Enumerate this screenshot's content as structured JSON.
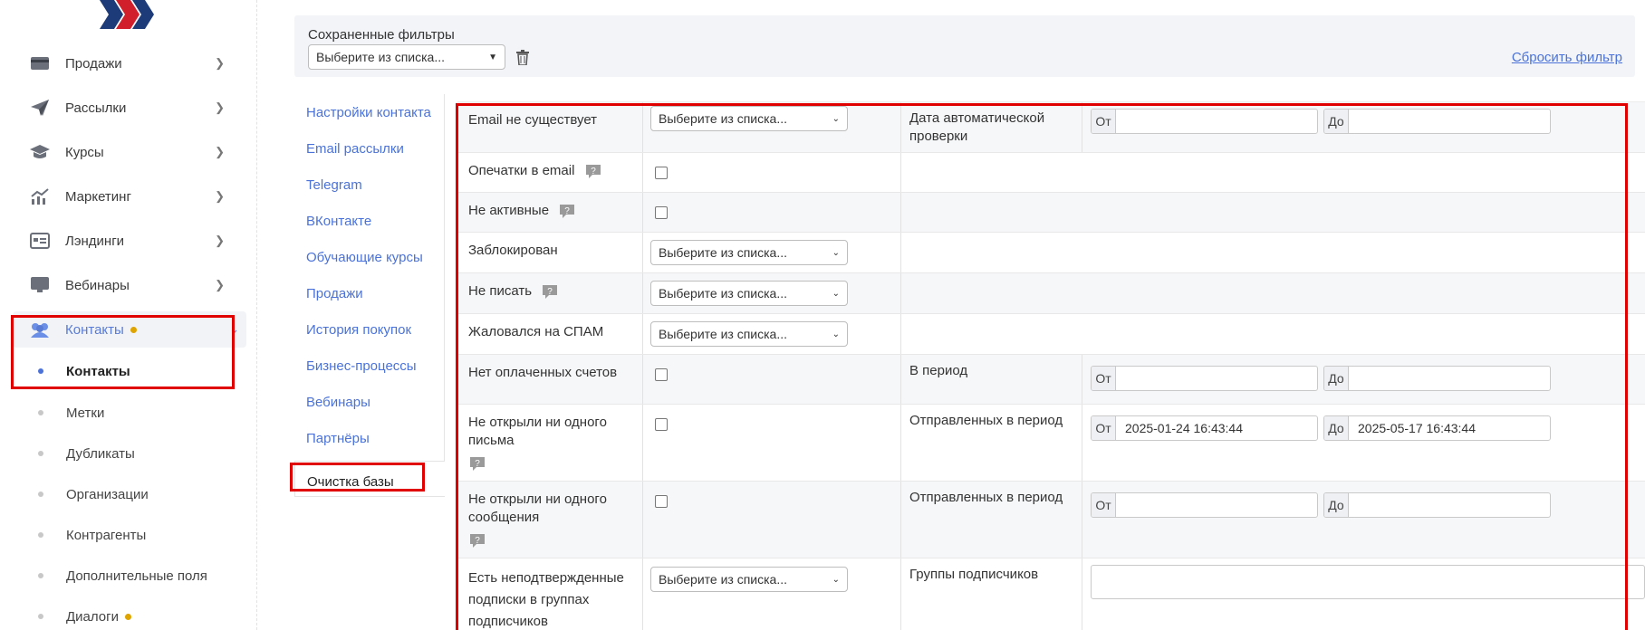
{
  "sidebar": {
    "menu": [
      {
        "label": "Продажи",
        "icon": "wallet-icon"
      },
      {
        "label": "Рассылки",
        "icon": "paper-plane-icon"
      },
      {
        "label": "Курсы",
        "icon": "graduation-cap-icon"
      },
      {
        "label": "Маркетинг",
        "icon": "growth-chart-icon"
      },
      {
        "label": "Лэндинги",
        "icon": "landing-page-icon"
      },
      {
        "label": "Вебинары",
        "icon": "monitor-icon"
      },
      {
        "label": "Контакты",
        "icon": "users-icon"
      }
    ],
    "submenu": [
      "Контакты",
      "Метки",
      "Дубликаты",
      "Организации",
      "Контрагенты",
      "Дополнительные поля",
      "Диалоги"
    ]
  },
  "saved_filters": {
    "title": "Сохраненные фильтры",
    "select_value": "Выберите из списка...",
    "reset_label": "Сбросить фильтр"
  },
  "tabs": [
    "Настройки контакта",
    "Email рассылки",
    "Telegram",
    "ВКонтакте",
    "Обучающие курсы",
    "Продажи",
    "История покупок",
    "Бизнес-процессы",
    "Вебинары",
    "Партнёры",
    "Очистка базы"
  ],
  "filters": {
    "select_placeholder": "Выберите из списка...",
    "from_label": "От",
    "to_label": "До",
    "rows": [
      {
        "label": "Email не существует"
      },
      {
        "label": "Опечатки в email"
      },
      {
        "label": "Не активные"
      },
      {
        "label": "Заблокирован"
      },
      {
        "label": "Не писать"
      },
      {
        "label": "Жаловался на СПАМ"
      },
      {
        "label": "Нет оплаченных счетов"
      },
      {
        "label": "Не открыли ни одного письма"
      },
      {
        "label": "Не открыли ни одного сообщения"
      },
      {
        "label": "Есть неподтвержденные подписки в группах подписчиков"
      }
    ],
    "right_labels": {
      "auto_check": "Дата автоматической проверки",
      "period": "В период",
      "sent_period_1": "Отправленных в период",
      "sent_period_2": "Отправленных в период",
      "subscriber_groups": "Группы подписчиков"
    },
    "sent_from_value": "2025-01-24 16:43:44",
    "sent_to_value": "2025-05-17 16:43:44"
  },
  "colors": {
    "link": "#4a72d8",
    "highlight": "#e00000",
    "dot": "#e0a400"
  }
}
